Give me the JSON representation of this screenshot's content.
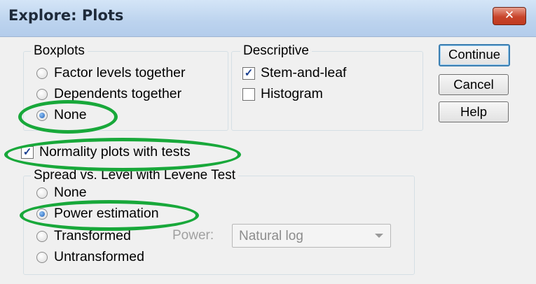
{
  "window": {
    "title": "Explore: Plots",
    "close_symbol": "✕"
  },
  "boxplots": {
    "legend": "Boxplots",
    "options": [
      "Factor levels together",
      "Dependents together",
      "None"
    ],
    "selected": "None"
  },
  "descriptive": {
    "legend": "Descriptive",
    "options": [
      {
        "label": "Stem-and-leaf",
        "checked": true
      },
      {
        "label": "Histogram",
        "checked": false
      }
    ]
  },
  "normality": {
    "label": "Normality plots with tests",
    "checked": true
  },
  "spread": {
    "legend": "Spread vs. Level with Levene Test",
    "options": [
      "None",
      "Power estimation",
      "Transformed",
      "Untransformed"
    ],
    "selected": "Power estimation",
    "power_label": "Power:",
    "power_value": "Natural log"
  },
  "buttons": {
    "continue": "Continue",
    "cancel": "Cancel",
    "help": "Help"
  },
  "annotation_color": "#18a83a"
}
